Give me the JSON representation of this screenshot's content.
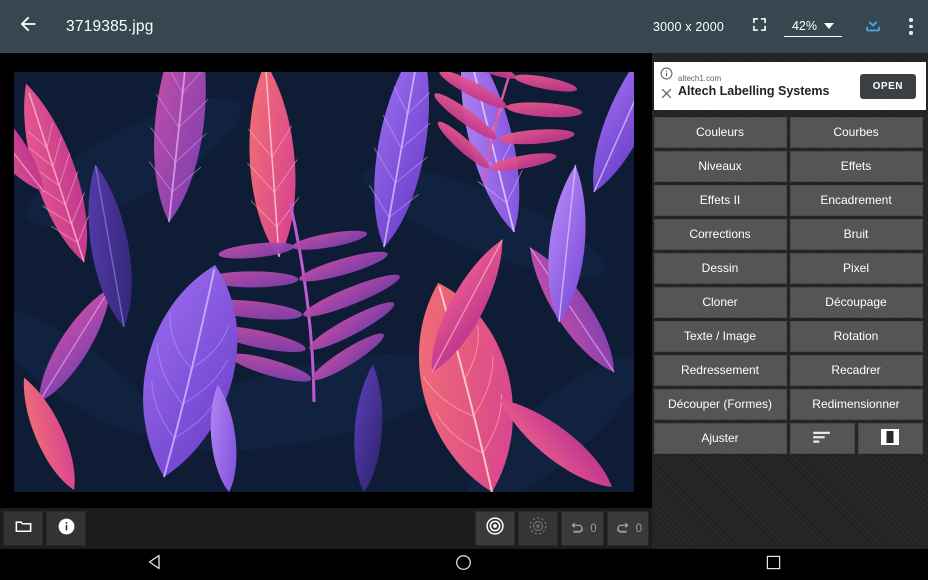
{
  "topbar": {
    "back_icon": "arrow-left-icon",
    "title": "3719385.jpg",
    "dimensions": "3000 x 2000",
    "fullscreen_icon": "fullscreen-icon",
    "zoom_value": "42%",
    "download_icon": "download-icon",
    "overflow_icon": "more-vertical-icon",
    "bar_color": "#37474f"
  },
  "ad": {
    "info_icon": "info-circle-icon",
    "close_icon": "close-x-icon",
    "url": "altech1.com",
    "title": "Altech Labelling Systems",
    "open_label": "OPEN"
  },
  "tools": {
    "buttons": [
      {
        "label": "Couleurs",
        "name": "tool-couleurs"
      },
      {
        "label": "Courbes",
        "name": "tool-courbes"
      },
      {
        "label": "Niveaux",
        "name": "tool-niveaux"
      },
      {
        "label": "Effets",
        "name": "tool-effets"
      },
      {
        "label": "Effets II",
        "name": "tool-effets-2"
      },
      {
        "label": "Encadrement",
        "name": "tool-encadrement"
      },
      {
        "label": "Corrections",
        "name": "tool-corrections"
      },
      {
        "label": "Bruit",
        "name": "tool-bruit"
      },
      {
        "label": "Dessin",
        "name": "tool-dessin"
      },
      {
        "label": "Pixel",
        "name": "tool-pixel"
      },
      {
        "label": "Cloner",
        "name": "tool-cloner"
      },
      {
        "label": "Découpage",
        "name": "tool-decoupage"
      },
      {
        "label": "Texte / Image",
        "name": "tool-texte-image"
      },
      {
        "label": "Rotation",
        "name": "tool-rotation"
      },
      {
        "label": "Redressement",
        "name": "tool-redressement"
      },
      {
        "label": "Recadrer",
        "name": "tool-recadrer"
      },
      {
        "label": "Découper (Formes)",
        "name": "tool-decouper-formes"
      },
      {
        "label": "Redimensionner",
        "name": "tool-redimensionner"
      },
      {
        "label": "Ajuster",
        "name": "tool-ajuster"
      }
    ],
    "histogram_icon": "histogram-align-icon",
    "compare_icon": "split-compare-icon",
    "button_color": "#555555"
  },
  "bottombar": {
    "folder_icon": "folder-icon",
    "info_icon": "info-icon",
    "target_icon": "target-active-icon",
    "target_dim_icon": "target-inactive-icon",
    "undo_icon": "undo-icon",
    "undo_count": "0",
    "redo_icon": "redo-icon",
    "redo_count": "0"
  },
  "navbar": {
    "back_icon": "nav-back-triangle-icon",
    "home_icon": "nav-home-circle-icon",
    "recents_icon": "nav-recents-square-icon"
  },
  "photo": {
    "background": "#0e1c35",
    "palette": [
      "#7b46d6",
      "#8f5ce8",
      "#a875f0",
      "#c94fa8",
      "#e0449a",
      "#ef5f8e",
      "#f4766f",
      "#5b3fb5",
      "#3b2a86"
    ]
  }
}
